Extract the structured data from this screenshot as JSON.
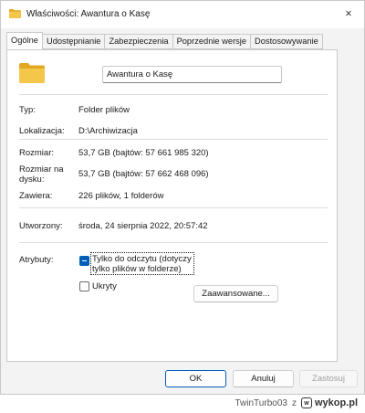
{
  "window": {
    "title": "Właściwości: Awantura o Kasę",
    "close_glyph": "✕"
  },
  "tabs": [
    {
      "label": "Ogólne",
      "active": true
    },
    {
      "label": "Udostępnianie",
      "active": false
    },
    {
      "label": "Zabezpieczenia",
      "active": false
    },
    {
      "label": "Poprzednie wersje",
      "active": false
    },
    {
      "label": "Dostosowywanie",
      "active": false
    }
  ],
  "general": {
    "folder_name": "Awantura o Kasę",
    "type_label": "Typ:",
    "type_value": "Folder plików",
    "location_label": "Lokalizacja:",
    "location_value": "D:\\Archiwizacja",
    "size_label": "Rozmiar:",
    "size_value": "53,7 GB (bajtów: 57 661 985 320)",
    "size_on_disk_label_1": "Rozmiar na",
    "size_on_disk_label_2": "dysku:",
    "size_on_disk_value": "53,7 GB (bajtów: 57 662 468 096)",
    "contains_label": "Zawiera:",
    "contains_value": "226 plików, 1 folderów",
    "created_label": "Utworzony:",
    "created_value": "środa, 24 sierpnia 2022, 20:57:42",
    "attributes_label": "Atrybuty:",
    "readonly_line1": "Tylko do odczytu (dotyczy",
    "readonly_line2": "tylko plików w folderze)",
    "readonly_state": "indeterminate",
    "hidden_label": "Ukryty",
    "hidden_state": "unchecked",
    "advanced_label": "Zaawansowane..."
  },
  "buttons": {
    "ok": "OK",
    "cancel": "Anuluj",
    "apply": "Zastosuj"
  },
  "credit": {
    "user": "TwinTurbo03",
    "separator": "z",
    "site": "wykop.pl"
  },
  "colors": {
    "accent": "#005fb8",
    "folder": "#f4c74a",
    "folder_dark": "#e2a823"
  }
}
